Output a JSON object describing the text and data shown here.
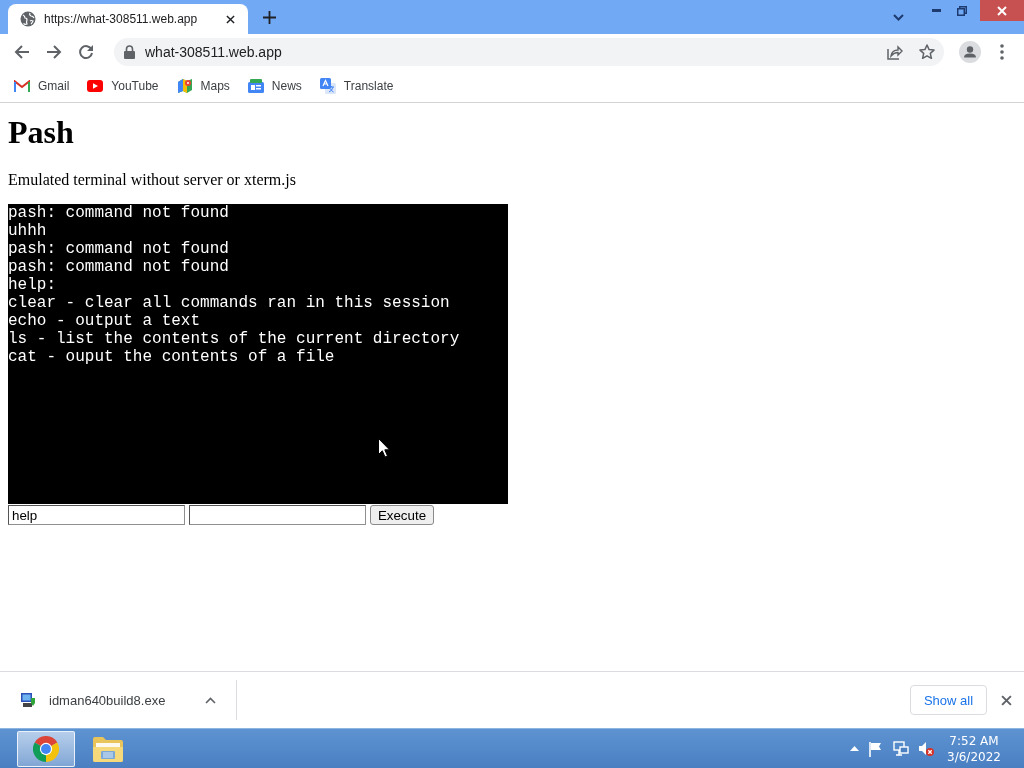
{
  "window": {
    "tabs": [
      {
        "title": "https://what-308511.web.app",
        "selected": true
      }
    ],
    "address": "what-308511.web.app",
    "bookmarks": [
      {
        "kind": "mail",
        "label": "Gmail"
      },
      {
        "kind": "video",
        "label": "YouTube"
      },
      {
        "kind": "map",
        "label": "Maps"
      },
      {
        "kind": "news",
        "label": "News"
      },
      {
        "kind": "translate",
        "label": "Translate"
      }
    ]
  },
  "page": {
    "title": "Pash",
    "subtitle": "Emulated terminal without server or xterm.js",
    "terminal_lines": [
      "pash: command not found",
      "uhhh",
      "pash: command not found",
      "pash: command not found",
      "help:",
      "clear - clear all commands ran in this session",
      "echo - output a text",
      "ls - list the contents of the current directory",
      "cat - ouput the contents of a file"
    ],
    "fields": [
      {
        "kind": "text",
        "value": "help"
      },
      {
        "kind": "text"
      }
    ],
    "button": "Execute"
  },
  "download_bar": {
    "file": "idman640build8.exe",
    "button": "Show all"
  },
  "taskbar": {
    "apps": [
      {
        "kind": "browser",
        "selected": true
      },
      {
        "kind": "folder",
        "selected": false
      }
    ],
    "clock": {
      "time": "7:52 AM",
      "date": "3/6/2022"
    }
  }
}
